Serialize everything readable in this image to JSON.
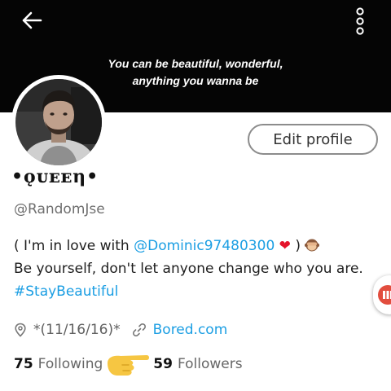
{
  "header": {
    "back_icon": "arrow-left-icon",
    "menu_icon": "more-vertical-icon",
    "quote_line1": "You can be beautiful, wonderful,",
    "quote_line2": "anything you wanna be"
  },
  "profile": {
    "display_name": "•ǫᴜᴇᴇη•",
    "handle": "@RandomJse",
    "edit_label": "Edit profile",
    "bio": {
      "part1": "( I'm in love with ",
      "mention": "@Dominic97480300",
      "heart": "❤",
      "part2": " )",
      "part3": "Be yourself, don't let anyone change who you are. ",
      "hashtag": "#StayBeautiful"
    },
    "location": "*(11/16/16)*",
    "website": "Bored.com",
    "following_count": "75",
    "following_label": "Following",
    "followers_count": "59",
    "followers_label": "Followers"
  },
  "colors": {
    "link": "#1b9ee3",
    "banner": "#050505",
    "heart": "#e5132b",
    "hand_emoji": "#f6c642",
    "side_tab": "#e24d3e"
  }
}
